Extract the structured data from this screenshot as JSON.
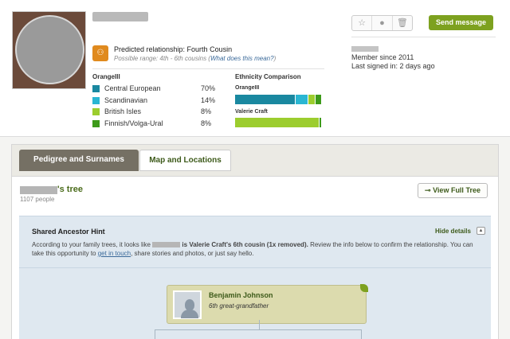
{
  "profile": {
    "relationship_label": "Predicted relationship: Fourth Cousin",
    "possible_range": "Possible range: 4th - 6th cousins",
    "what_does_mean": "What does this mean?",
    "send_message": "Send message",
    "member_since": "Member since 2011",
    "last_signed_in": "Last signed in: 2 days ago"
  },
  "ethnicity": {
    "user": "OrangeIII",
    "rows": [
      {
        "label": "Central European",
        "pct": "70%",
        "color": "#1a88a0"
      },
      {
        "label": "Scandinavian",
        "pct": "14%",
        "color": "#2ab6d2"
      },
      {
        "label": "British Isles",
        "pct": "8%",
        "color": "#9ccd2e"
      },
      {
        "label": "Finnish/Volga-Ural",
        "pct": "8%",
        "color": "#3d9a1a"
      }
    ],
    "comparison_title": "Ethnicity Comparison",
    "cmp_user1": "OrangeIII",
    "cmp_user2": "Valerie Craft"
  },
  "tabs": {
    "pedigree": "Pedigree and Surnames",
    "map": "Map and Locations"
  },
  "tree": {
    "title_suffix": "'s tree",
    "count": "1107 people",
    "view_full": "View Full Tree"
  },
  "hint": {
    "title": "Shared Ancestor Hint",
    "hide_details": "Hide details",
    "text_a": "According to your family trees, it looks like",
    "text_b": "is Valerie Craft's 6th cousin (1x removed).",
    "text_c": "Review the info below to confirm the relationship. You can take this opportunity to",
    "link": "get in touch",
    "text_d": ", share stories and photos, or just say hello."
  },
  "ancestor": {
    "name": "Benjamin Johnson",
    "relation": "6th great-grandfather"
  }
}
